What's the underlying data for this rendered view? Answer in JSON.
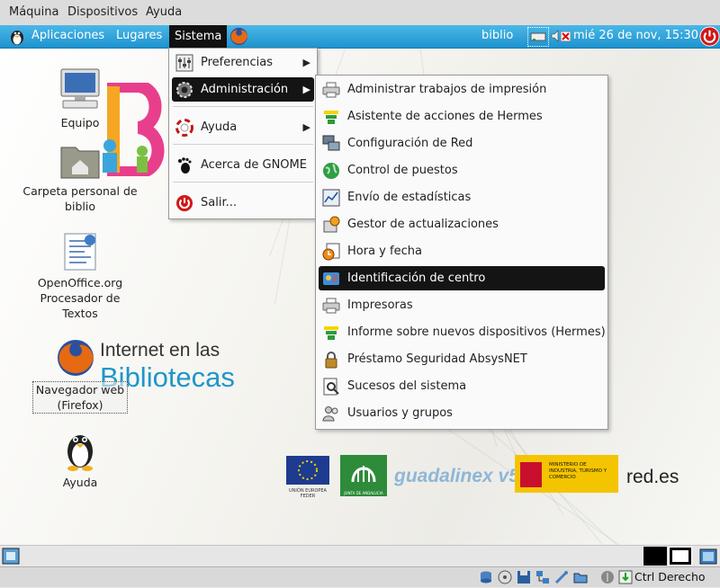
{
  "host_menu": [
    "Máquina",
    "Dispositivos",
    "Ayuda"
  ],
  "top_panel": {
    "menus": [
      "Aplicaciones",
      "Lugares",
      "Sistema"
    ],
    "user": "biblio",
    "datetime": "mié 26 de nov, 15:30"
  },
  "desktop_icons": [
    {
      "label": "Equipo",
      "icon": "computer-icon"
    },
    {
      "label": "Carpeta personal de biblio",
      "icon": "home-folder-icon"
    },
    {
      "label": "OpenOffice.org Procesador de Textos",
      "icon": "writer-document-icon"
    },
    {
      "label": "Navegador web (Firefox)",
      "icon": "firefox-icon"
    },
    {
      "label": "Ayuda",
      "icon": "tux-help-icon"
    }
  ],
  "wallpaper": {
    "brand_line1": "Internet en las",
    "brand_line2": "Bibliotecas",
    "logos": {
      "eu_caption": "UNIÓN EUROPEA FEDER",
      "junta_caption": "JUNTA DE ANDALUCIA",
      "guadalinex": "guadalinex v5",
      "ministerio": "MINISTERIO DE INDUSTRIA, TURISMO Y COMERCIO",
      "redes": "red.es"
    }
  },
  "sistema_menu": {
    "items": [
      {
        "label": "Preferencias",
        "submenu": true,
        "icon": "preferences-icon"
      },
      {
        "label": "Administración",
        "submenu": true,
        "icon": "administration-gear-icon",
        "active": true
      },
      {
        "label": "Ayuda",
        "submenu": true,
        "icon": "lifebuoy-help-icon"
      },
      {
        "label": "Acerca de GNOME",
        "submenu": false,
        "icon": "gnome-foot-icon"
      },
      {
        "label": "Salir...",
        "submenu": false,
        "icon": "power-icon"
      }
    ]
  },
  "admin_menu": {
    "items": [
      {
        "label": "Administrar trabajos de impresión",
        "icon": "printer-icon"
      },
      {
        "label": "Asistente de acciones de Hermes",
        "icon": "hermes-icon"
      },
      {
        "label": "Configuración de Red",
        "icon": "network-icon"
      },
      {
        "label": "Control de puestos",
        "icon": "globe-icon"
      },
      {
        "label": "Envío de estadísticas",
        "icon": "chart-icon"
      },
      {
        "label": "Gestor de actualizaciones",
        "icon": "update-icon"
      },
      {
        "label": "Hora y fecha",
        "icon": "clock-icon"
      },
      {
        "label": "Identificación de centro",
        "icon": "identification-icon",
        "highlighted": true
      },
      {
        "label": "Impresoras",
        "icon": "printer-icon"
      },
      {
        "label": "Informe sobre nuevos dispositivos (Hermes)",
        "icon": "hermes-icon"
      },
      {
        "label": "Préstamo Seguridad AbsysNET",
        "icon": "lock-icon"
      },
      {
        "label": "Sucesos del sistema",
        "icon": "log-search-icon"
      },
      {
        "label": "Usuarios y grupos",
        "icon": "users-icon"
      }
    ]
  },
  "status_bar": {
    "host_key": "Ctrl Derecho"
  },
  "colors": {
    "panel_blue": "#2aa3dc",
    "highlight": "#141414",
    "menu_bg": "#fafafa"
  }
}
